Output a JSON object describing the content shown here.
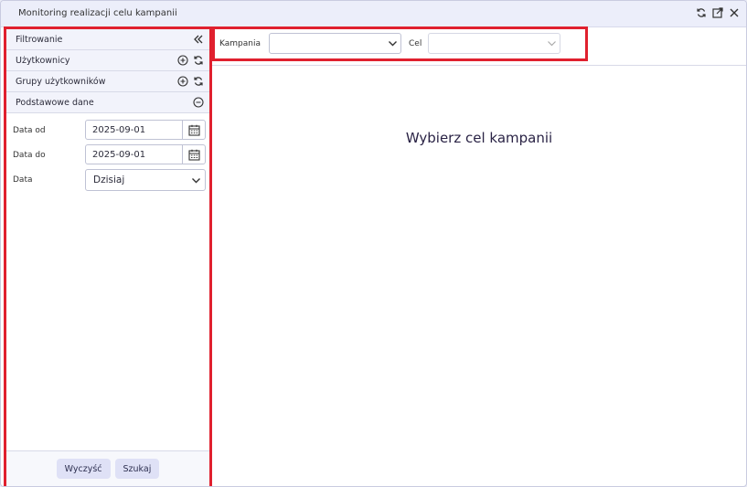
{
  "window": {
    "title": "Monitoring realizacji celu kampanii",
    "icons": [
      "refresh-icon",
      "popout-icon",
      "close-icon"
    ]
  },
  "sidebar": {
    "sections": [
      {
        "label": "Filtrowanie",
        "icon": "collapse-double-chevron-icon"
      },
      {
        "label": "Użytkownicy",
        "icons": [
          "add-circle-icon",
          "refresh-icon"
        ]
      },
      {
        "label": "Grupy użytkowników",
        "icons": [
          "add-circle-icon",
          "refresh-icon"
        ]
      },
      {
        "label": "Podstawowe dane",
        "icon": "minus-circle-icon"
      }
    ],
    "form": {
      "date_from": {
        "label": "Data od",
        "value": "2025-09-01"
      },
      "date_to": {
        "label": "Data do",
        "value": "2025-09-01"
      },
      "date_preset": {
        "label": "Data",
        "value": "Dzisiaj"
      }
    },
    "footer": {
      "clear_label": "Wyczyść",
      "search_label": "Szukaj"
    }
  },
  "topbar": {
    "campaign": {
      "label": "Kampania",
      "value": ""
    },
    "goal": {
      "label": "Cel",
      "value": ""
    }
  },
  "main": {
    "message": "Wybierz cel kampanii"
  },
  "colors": {
    "highlight": "#e0202e",
    "button_bg": "#dfe1f6",
    "titlebar_bg": "#eceefa"
  }
}
